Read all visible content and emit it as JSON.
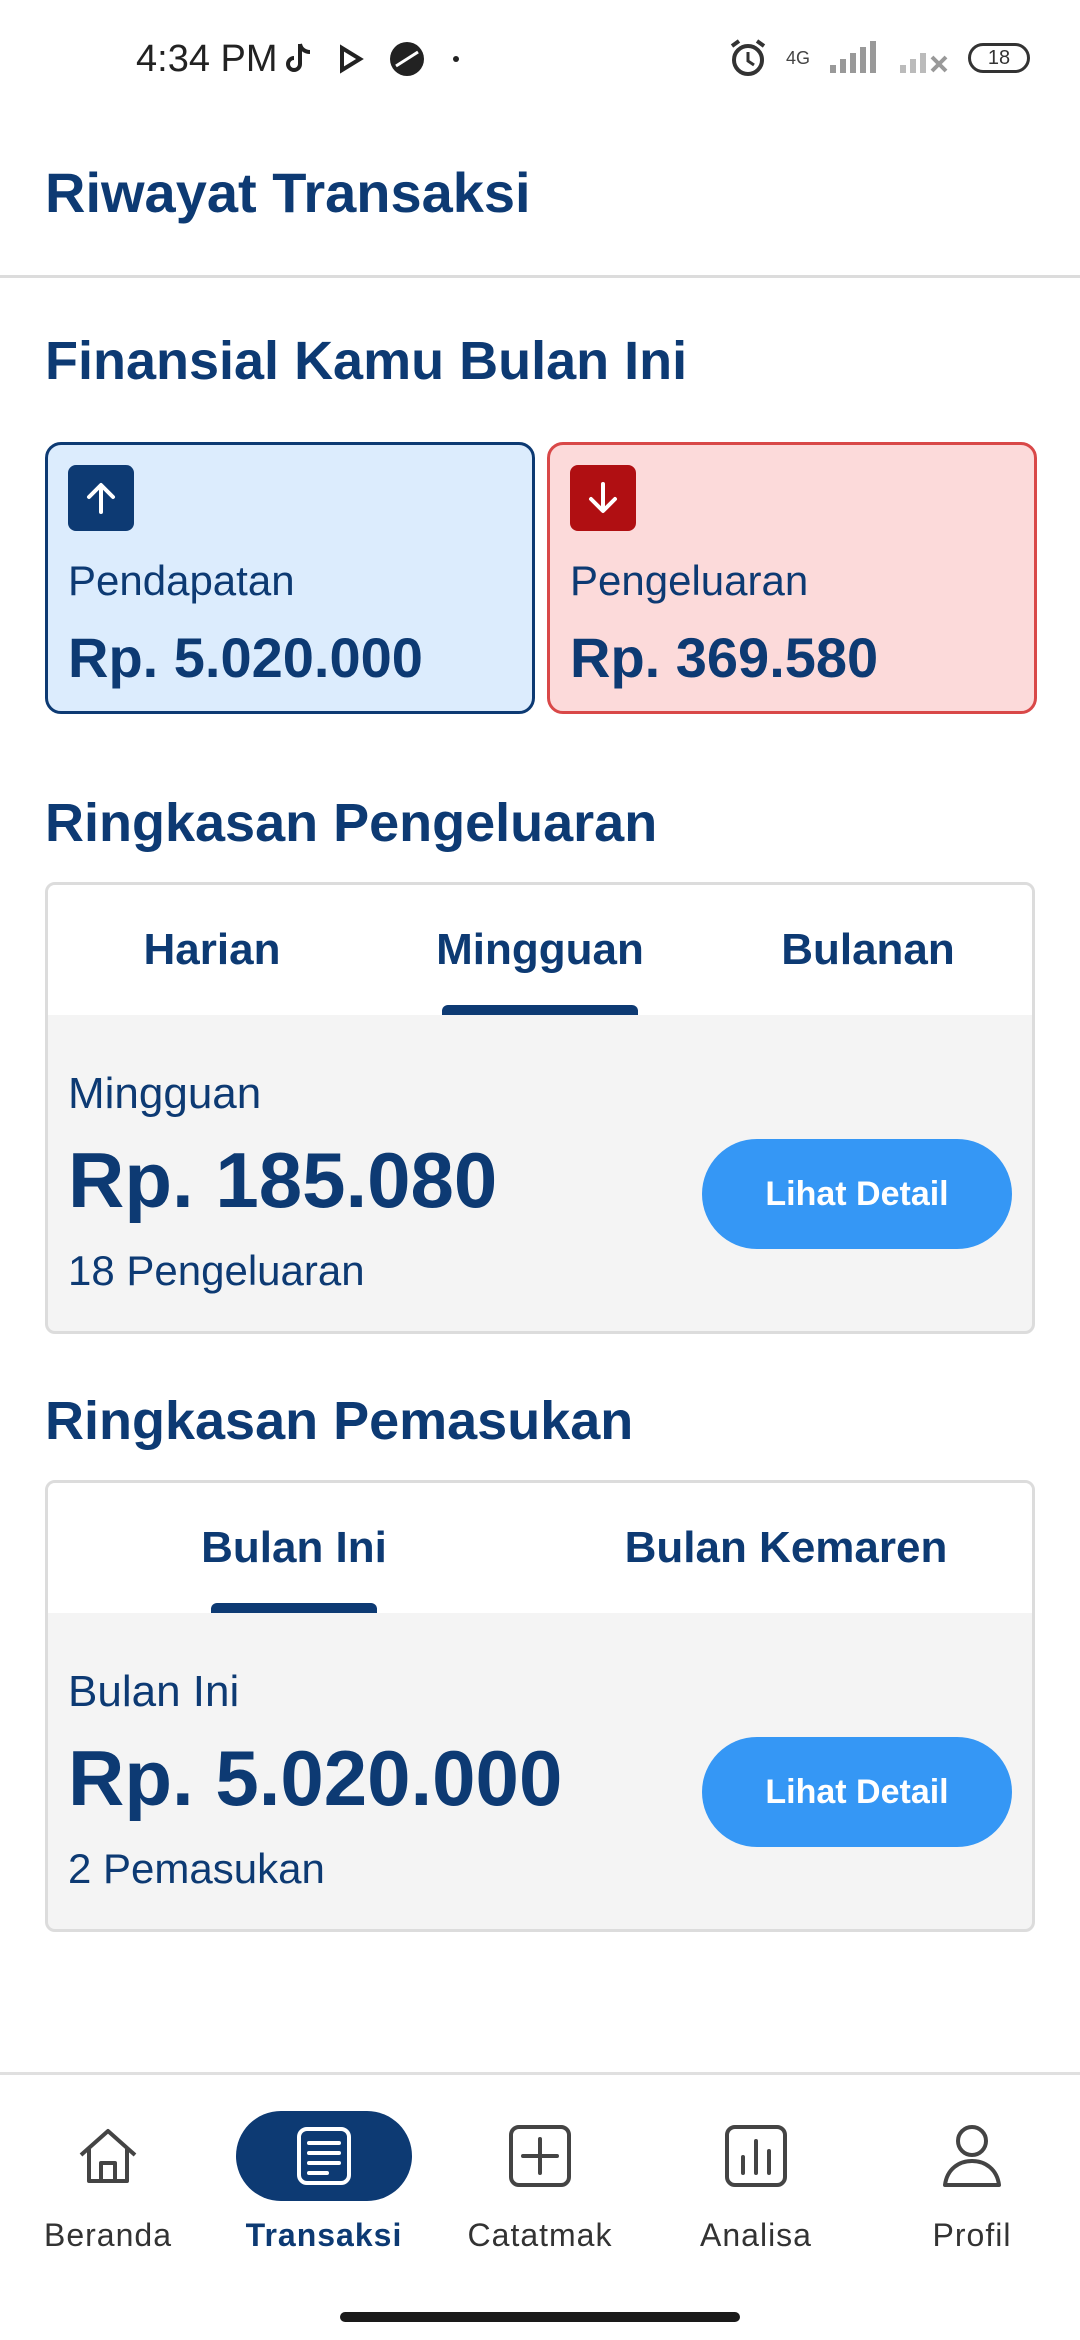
{
  "status_bar": {
    "time": "4:34 PM",
    "network": "4G",
    "battery": "18"
  },
  "header": {
    "title": "Riwayat Transaksi"
  },
  "finance": {
    "title": "Finansial Kamu Bulan Ini",
    "income": {
      "label": "Pendapatan",
      "amount": "Rp. 5.020.000",
      "icon": "arrow-up-icon"
    },
    "expense": {
      "label": "Pengeluaran",
      "amount": "Rp. 369.580",
      "icon": "arrow-down-icon"
    }
  },
  "expense_summary": {
    "title": "Ringkasan Pengeluaran",
    "tabs": [
      {
        "label": "Harian",
        "active": false
      },
      {
        "label": "Mingguan",
        "active": true
      },
      {
        "label": "Bulanan",
        "active": false
      }
    ],
    "period_label": "Mingguan",
    "amount": "Rp. 185.080",
    "count": "18 Pengeluaran",
    "button_label": "Lihat Detail"
  },
  "income_summary": {
    "title": "Ringkasan Pemasukan",
    "tabs": [
      {
        "label": "Bulan Ini",
        "active": true
      },
      {
        "label": "Bulan Kemaren",
        "active": false
      }
    ],
    "period_label": "Bulan Ini",
    "amount": "Rp. 5.020.000",
    "count": "2 Pemasukan",
    "button_label": "Lihat Detail"
  },
  "bottom_nav": {
    "items": [
      {
        "label": "Beranda",
        "icon": "home-icon",
        "active": false
      },
      {
        "label": "Transaksi",
        "icon": "document-icon",
        "active": true
      },
      {
        "label": "Catatmak",
        "icon": "add-square-icon",
        "active": false
      },
      {
        "label": "Analisa",
        "icon": "chart-icon",
        "active": false
      },
      {
        "label": "Profil",
        "icon": "user-icon",
        "active": false
      }
    ]
  },
  "colors": {
    "primary": "#0d3a73",
    "accent_button": "#3597f5",
    "income_bg": "#dcecfd",
    "expense_bg": "#fcdada",
    "expense_border": "#d94848",
    "expense_icon": "#b00f12"
  }
}
